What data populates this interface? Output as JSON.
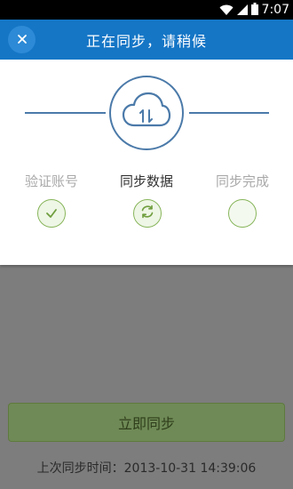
{
  "status_bar": {
    "time": "7:07",
    "icons": [
      "wifi-icon",
      "signal-icon",
      "battery-icon"
    ]
  },
  "dialog": {
    "title": "正在同步，请稍候",
    "close_icon": "close-icon",
    "center_icon": "cloud-sync-icon",
    "steps": [
      {
        "label": "验证账号",
        "state": "done",
        "icon": "check-icon"
      },
      {
        "label": "同步数据",
        "state": "active",
        "icon": "refresh-icon"
      },
      {
        "label": "同步完成",
        "state": "pending",
        "icon": ""
      }
    ]
  },
  "background": {
    "sync_now_label": "立即同步",
    "last_sync_text": "上次同步时间：2013-10-31 14:39:06"
  },
  "colors": {
    "header": "#1576c6",
    "accent_line": "#4b7aa9",
    "step_green": "#87b55a"
  }
}
